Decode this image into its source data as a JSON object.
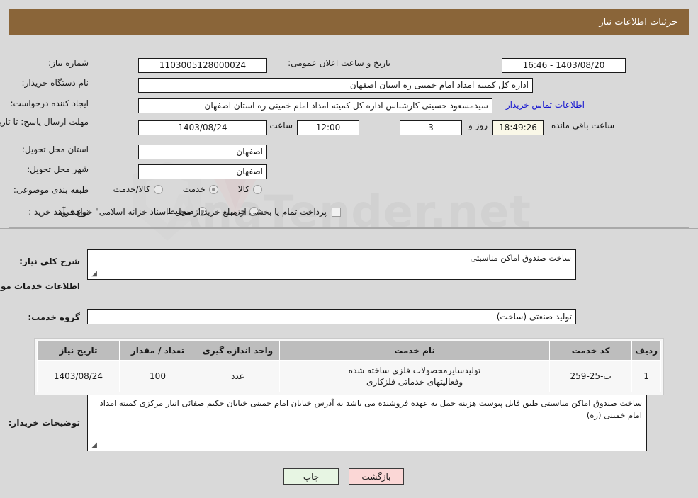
{
  "header": {
    "title": "جزئیات اطلاعات نیاز"
  },
  "watermark": {
    "text": "AnaTender.net"
  },
  "form": {
    "need_number_label": "شماره نیاز:",
    "need_number_value": "1103005128000024",
    "announce_datetime_label": "تاریخ و ساعت اعلان عمومی:",
    "announce_datetime_value": "1403/08/20 - 16:46",
    "buyer_org_label": "نام دستگاه خریدار:",
    "buyer_org_value": "اداره کل کمیته امداد امام خمینی  ره  استان اصفهان",
    "requester_label": "ایجاد کننده درخواست:",
    "requester_value": "سیدمسعود حسینی کارشناس اداره کل کمیته امداد امام خمینی  ره  استان اصفهان",
    "contact_link": "اطلاعات تماس خریدار",
    "deadline_label": "مهلت ارسال پاسخ: تا تاریخ:",
    "deadline_date": "1403/08/24",
    "deadline_hour_label": "ساعت",
    "deadline_hour_value": "12:00",
    "days_value": "3",
    "days_label": "روز و",
    "remaining_time_value": "18:49:26",
    "remaining_label": "ساعت باقی مانده",
    "province_label": "استان محل تحویل:",
    "province_value": "اصفهان",
    "city_label": "شهر محل تحویل:",
    "city_value": "اصفهان",
    "category_label": "طبقه بندی موضوعی:",
    "category_options": [
      {
        "label": "کالا",
        "selected": false
      },
      {
        "label": "خدمت",
        "selected": true
      },
      {
        "label": "کالا/خدمت",
        "selected": false
      }
    ],
    "process_label": "نوع فرآیند خرید :",
    "process_options": [
      {
        "label": "جزیی",
        "selected": false
      },
      {
        "label": "متوسط",
        "selected": true
      }
    ],
    "treasury_checkbox_checked": false,
    "treasury_note": "پرداخت تمام یا بخشی از مبلغ خرید،از محل \"اسناد خزانه اسلامی\" خواهد بود."
  },
  "summary": {
    "label": "شرح کلی نیاز:",
    "value": "ساخت صندوق اماکن مناسبتی"
  },
  "services_section": {
    "title": "اطلاعات خدمات مورد نیاز",
    "group_label": "گروه خدمت:",
    "group_value": "تولید صنعتی (ساخت)"
  },
  "table": {
    "columns": [
      "ردیف",
      "کد خدمت",
      "نام خدمت",
      "واحد اندازه گیری",
      "تعداد / مقدار",
      "تاریخ نیاز"
    ],
    "rows": [
      {
        "row_no": "1",
        "service_code": "ب-25-259",
        "service_name": "تولیدسایرمحصولات فلزی ساخته شده وفعالیتهای خدماتی فلزکاری",
        "unit": "عدد",
        "quantity": "100",
        "need_date": "1403/08/24"
      }
    ]
  },
  "notes": {
    "label": "توضیحات خریدار:",
    "value": "ساخت صندوق اماکن مناسبتی طبق فایل پیوست هزینه حمل به عهده فروشنده می باشد به آدرس خیابان امام خمینی خیابان حکیم صفائی انبار مرکزی کمیته امداد امام خمینی (ره)"
  },
  "footer": {
    "print_label": "چاپ",
    "back_label": "بازگشت"
  }
}
